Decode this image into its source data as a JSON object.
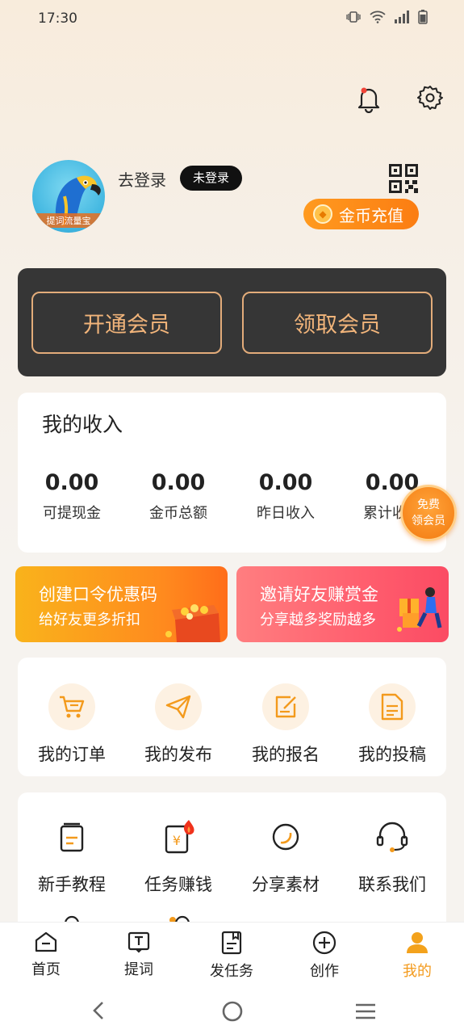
{
  "status_bar": {
    "time": "17:30"
  },
  "profile": {
    "avatar_caption": "提词流量宝",
    "login_text": "去登录",
    "badge": "未登录",
    "recharge_label": "金币充值"
  },
  "membership": {
    "open_label": "开通会员",
    "claim_label": "领取会员"
  },
  "income": {
    "title": "我的收入",
    "stats": [
      {
        "value": "0.00",
        "label": "可提现金"
      },
      {
        "value": "0.00",
        "label": "金币总额"
      },
      {
        "value": "0.00",
        "label": "昨日收入"
      },
      {
        "value": "0.00",
        "label": "累计收入"
      }
    ],
    "float_badge": {
      "line1": "免费",
      "line2": "领会员"
    }
  },
  "promos": [
    {
      "title": "创建口令优惠码",
      "subtitle": "给好友更多折扣"
    },
    {
      "title": "邀请好友赚赏金",
      "subtitle": "分享越多奖励越多"
    }
  ],
  "orders_grid": [
    {
      "label": "我的订单",
      "icon": "cart-icon"
    },
    {
      "label": "我的发布",
      "icon": "paper-plane-icon"
    },
    {
      "label": "我的报名",
      "icon": "edit-note-icon"
    },
    {
      "label": "我的投稿",
      "icon": "document-icon"
    }
  ],
  "tools_grid": [
    {
      "label": "新手教程",
      "icon": "book-icon"
    },
    {
      "label": "任务赚钱",
      "icon": "money-task-icon"
    },
    {
      "label": "分享素材",
      "icon": "share-material-icon"
    },
    {
      "label": "联系我们",
      "icon": "headset-icon"
    }
  ],
  "bottom_nav": [
    {
      "label": "首页",
      "icon": "home-icon"
    },
    {
      "label": "提词",
      "icon": "teleprompter-icon"
    },
    {
      "label": "发任务",
      "icon": "task-icon"
    },
    {
      "label": "创作",
      "icon": "plus-circle-icon"
    },
    {
      "label": "我的",
      "icon": "profile-icon",
      "active": true
    }
  ],
  "colors": {
    "accent": "#f39a1c",
    "member_card_bg": "#363636",
    "member_border": "#e3ac7a"
  }
}
